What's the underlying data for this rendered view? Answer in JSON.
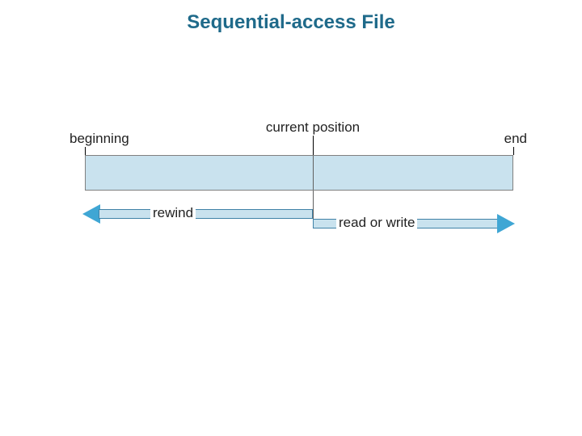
{
  "title": "Sequential-access File",
  "labels": {
    "beginning": "beginning",
    "current_position": "current position",
    "end": "end",
    "rewind": "rewind",
    "read_or_write": "read or write"
  },
  "colors": {
    "title": "#1f6a8a",
    "bar_fill": "#c9e2ee",
    "arrow_fill": "#3fa6d4"
  }
}
